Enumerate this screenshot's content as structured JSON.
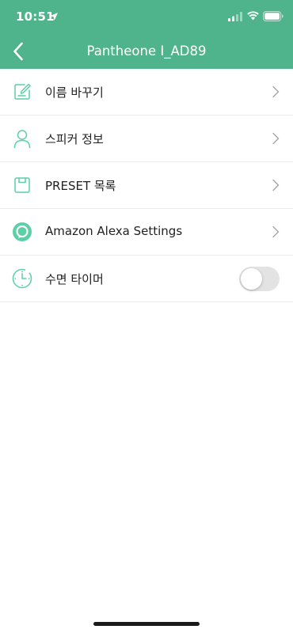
{
  "status_bar": {
    "time": "10:51",
    "icons": [
      "location-arrow-icon",
      "cellular-signal-icon",
      "wifi-icon",
      "battery-icon"
    ]
  },
  "nav": {
    "title": "Pantheone I_AD89",
    "back_icon": "chevron-left-icon"
  },
  "menu": {
    "items": [
      {
        "label": "이름 바꾸기",
        "icon": "edit-icon",
        "accessory": "chevron-right-icon"
      },
      {
        "label": "스피커 정보",
        "icon": "person-icon",
        "accessory": "chevron-right-icon"
      },
      {
        "label": "PRESET 목록",
        "icon": "save-icon",
        "accessory": "chevron-right-icon"
      },
      {
        "label": "Amazon Alexa Settings",
        "icon": "alexa-icon",
        "accessory": "chevron-right-icon"
      },
      {
        "label": "수면 타이머",
        "icon": "clock-icon",
        "accessory": "toggle",
        "toggle_on": false
      }
    ]
  },
  "colors": {
    "header_background": "#4fb48b",
    "icon_accent": "#5ccfa6",
    "toggle_off": "#e3e3e3"
  }
}
